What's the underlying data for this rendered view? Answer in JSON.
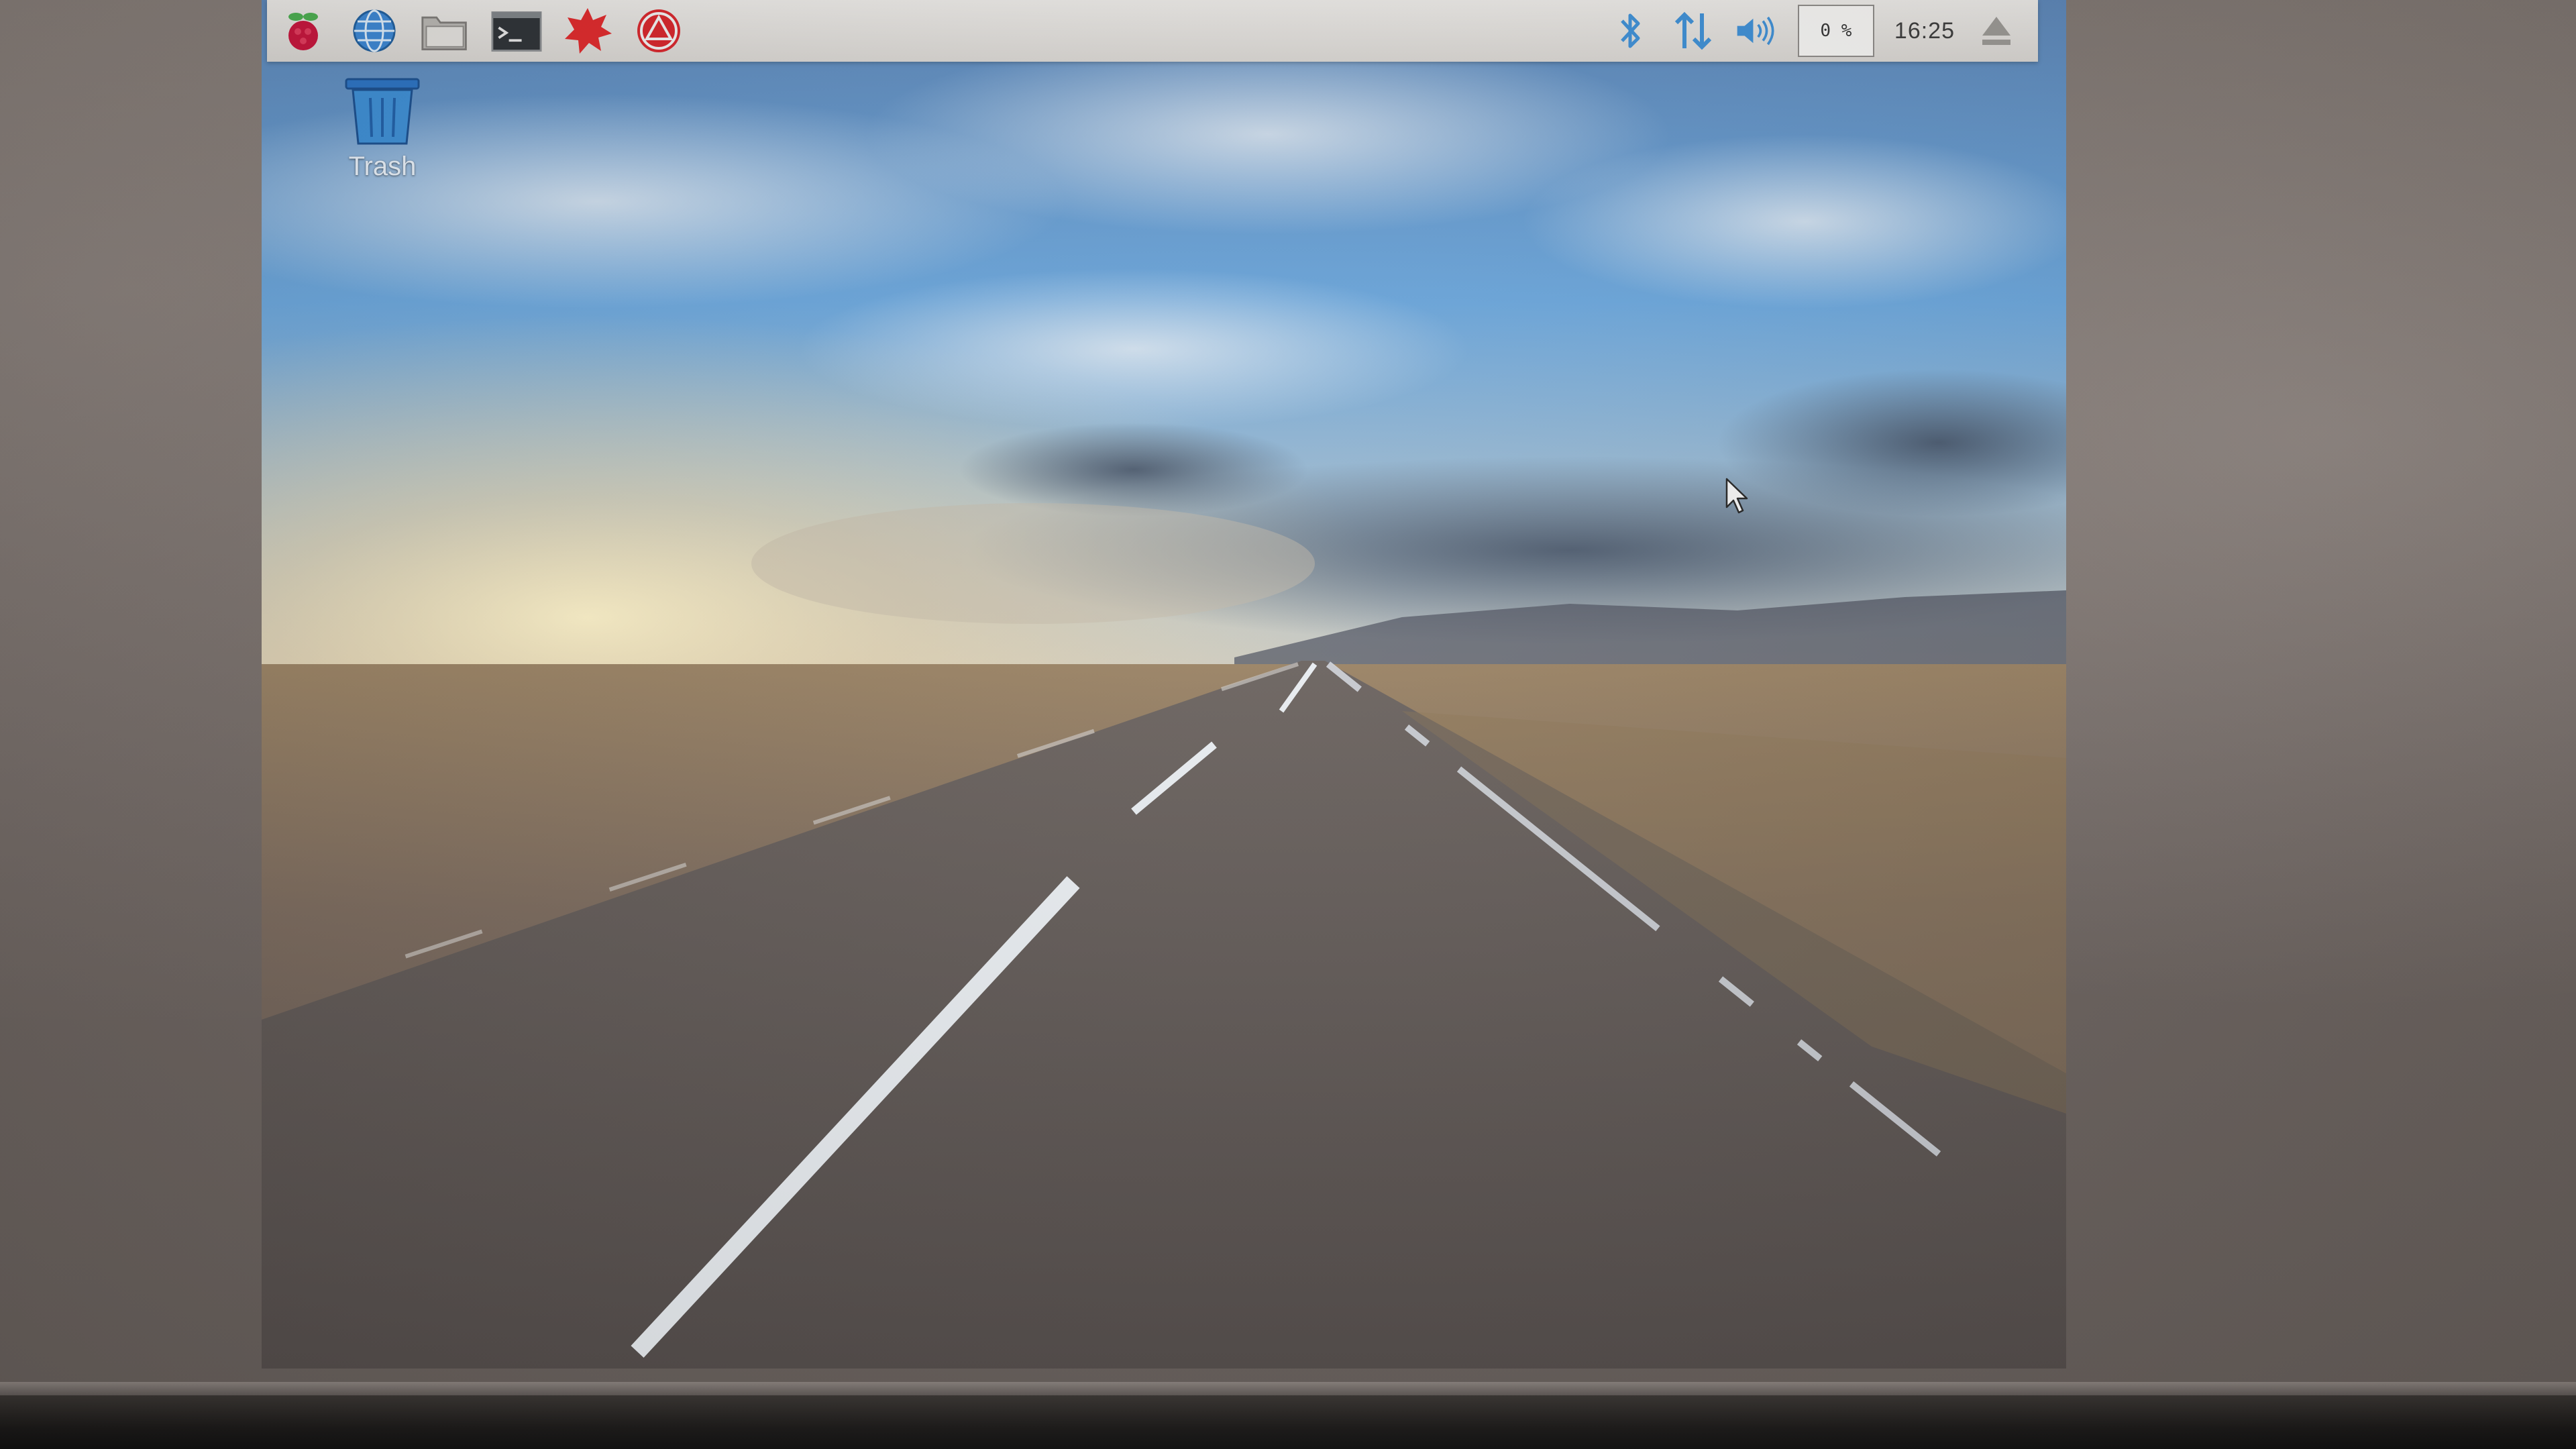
{
  "panel": {
    "launchers": [
      {
        "name": "raspberry-menu-icon",
        "tooltip": ""
      },
      {
        "name": "web-browser-icon",
        "tooltip": ""
      },
      {
        "name": "file-manager-icon",
        "tooltip": ""
      },
      {
        "name": "terminal-icon",
        "tooltip": ""
      },
      {
        "name": "wolfram-icon",
        "tooltip": ""
      },
      {
        "name": "mathematica-icon",
        "tooltip": ""
      }
    ],
    "tray": {
      "bluetooth_icon": "bluetooth-icon",
      "network_icon": "network-icon",
      "volume_icon": "volume-icon",
      "cpu_usage": "0 %",
      "clock": "16:25",
      "eject_icon": "eject-icon"
    }
  },
  "desktop": {
    "trash_label": "Trash"
  },
  "colors": {
    "panel_bg": "#e3e0dc",
    "tray_accent": "#3d8fd6",
    "wallpaper_sky": "#5a9ad6",
    "wallpaper_road": "#5a5452"
  }
}
